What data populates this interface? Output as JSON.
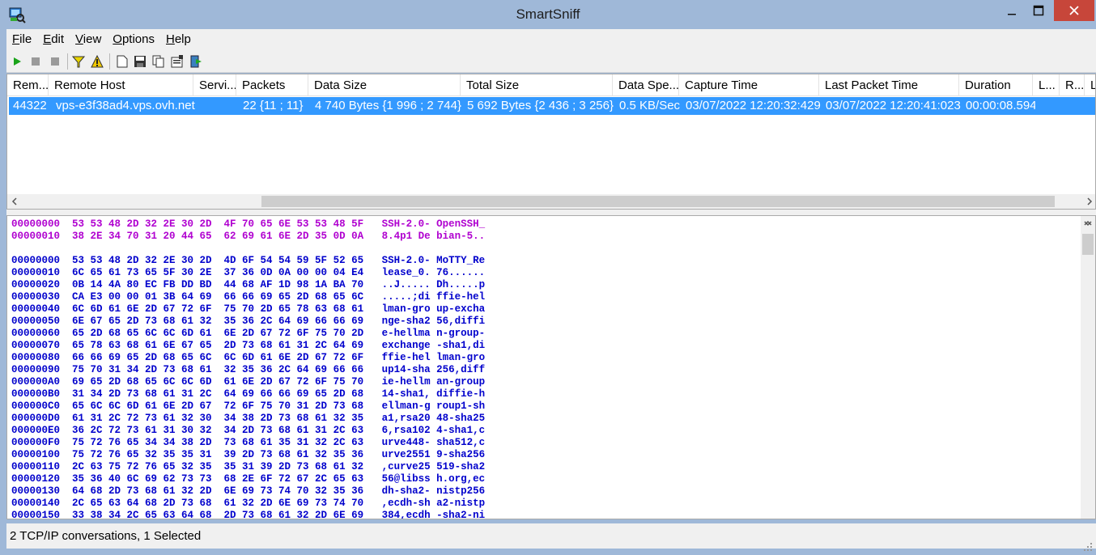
{
  "window": {
    "title": "SmartSniff",
    "colors": {
      "titlebar": "#9fb8d8",
      "close": "#c7463a",
      "selection": "#3399ff",
      "client_text": "#b000d0",
      "server_text": "#0000cc"
    }
  },
  "menu": [
    {
      "mnemonic": "F",
      "rest": "ile"
    },
    {
      "mnemonic": "E",
      "rest": "dit"
    },
    {
      "mnemonic": "V",
      "rest": "iew"
    },
    {
      "mnemonic": "O",
      "rest": "ptions"
    },
    {
      "mnemonic": "H",
      "rest": "elp"
    }
  ],
  "toolbar": {
    "icons": [
      "start-capture-icon",
      "stop-capture-icon",
      "pause-icon",
      "filter-icon",
      "warning-filter-icon",
      "new-file-icon",
      "save-icon",
      "copy-icon",
      "properties-icon",
      "exit-icon"
    ]
  },
  "columns": [
    "Rem...",
    "Remote Host",
    "Servi...",
    "Packets",
    "Data Size",
    "Total Size",
    "Data Spe...",
    "Capture Time",
    "Last Packet Time",
    "Duration",
    "L...",
    "R...",
    "L"
  ],
  "rows": [
    {
      "remote_port": "44322",
      "remote_host": "vps-e3f38ad4.vps.ovh.net",
      "service": "",
      "packets": "22  {11 ; 11}",
      "data_size": "4 740 Bytes  {1 996 ; 2 744}",
      "total_size": "5 692 Bytes  {2 436 ; 3 256}",
      "data_speed": "0.5 KB/Sec",
      "capture_time": "03/07/2022 12:20:32:429",
      "last_packet_time": "03/07/2022 12:20:41:023",
      "duration": "00:00:08.594"
    }
  ],
  "hex_dump": [
    {
      "kind": "client",
      "text": "00000000  53 53 48 2D 32 2E 30 2D  4F 70 65 6E 53 53 48 5F   SSH-2.0- OpenSSH_"
    },
    {
      "kind": "client",
      "text": "00000010  38 2E 34 70 31 20 44 65  62 69 61 6E 2D 35 0D 0A   8.4p1 De bian-5.."
    },
    {
      "kind": "blank",
      "text": ""
    },
    {
      "kind": "server",
      "text": "00000000  53 53 48 2D 32 2E 30 2D  4D 6F 54 54 59 5F 52 65   SSH-2.0- MoTTY_Re"
    },
    {
      "kind": "server",
      "text": "00000010  6C 65 61 73 65 5F 30 2E  37 36 0D 0A 00 00 04 E4   lease_0. 76......"
    },
    {
      "kind": "server",
      "text": "00000020  0B 14 4A 80 EC FB DD BD  44 68 AF 1D 98 1A BA 70   ..J..... Dh.....p"
    },
    {
      "kind": "server",
      "text": "00000030  CA E3 00 00 01 3B 64 69  66 66 69 65 2D 68 65 6C   .....;di ffie-hel"
    },
    {
      "kind": "server",
      "text": "00000040  6C 6D 61 6E 2D 67 72 6F  75 70 2D 65 78 63 68 61   lman-gro up-excha"
    },
    {
      "kind": "server",
      "text": "00000050  6E 67 65 2D 73 68 61 32  35 36 2C 64 69 66 66 69   nge-sha2 56,diffi"
    },
    {
      "kind": "server",
      "text": "00000060  65 2D 68 65 6C 6C 6D 61  6E 2D 67 72 6F 75 70 2D   e-hellma n-group-"
    },
    {
      "kind": "server",
      "text": "00000070  65 78 63 68 61 6E 67 65  2D 73 68 61 31 2C 64 69   exchange -sha1,di"
    },
    {
      "kind": "server",
      "text": "00000080  66 66 69 65 2D 68 65 6C  6C 6D 61 6E 2D 67 72 6F   ffie-hel lman-gro"
    },
    {
      "kind": "server",
      "text": "00000090  75 70 31 34 2D 73 68 61  32 35 36 2C 64 69 66 66   up14-sha 256,diff"
    },
    {
      "kind": "server",
      "text": "000000A0  69 65 2D 68 65 6C 6C 6D  61 6E 2D 67 72 6F 75 70   ie-hellm an-group"
    },
    {
      "kind": "server",
      "text": "000000B0  31 34 2D 73 68 61 31 2C  64 69 66 66 69 65 2D 68   14-sha1, diffie-h"
    },
    {
      "kind": "server",
      "text": "000000C0  65 6C 6C 6D 61 6E 2D 67  72 6F 75 70 31 2D 73 68   ellman-g roup1-sh"
    },
    {
      "kind": "server",
      "text": "000000D0  61 31 2C 72 73 61 32 30  34 38 2D 73 68 61 32 35   a1,rsa20 48-sha25"
    },
    {
      "kind": "server",
      "text": "000000E0  36 2C 72 73 61 31 30 32  34 2D 73 68 61 31 2C 63   6,rsa102 4-sha1,c"
    },
    {
      "kind": "server",
      "text": "000000F0  75 72 76 65 34 34 38 2D  73 68 61 35 31 32 2C 63   urve448- sha512,c"
    },
    {
      "kind": "server",
      "text": "00000100  75 72 76 65 32 35 35 31  39 2D 73 68 61 32 35 36   urve2551 9-sha256"
    },
    {
      "kind": "server",
      "text": "00000110  2C 63 75 72 76 65 32 35  35 31 39 2D 73 68 61 32   ,curve25 519-sha2"
    },
    {
      "kind": "server",
      "text": "00000120  35 36 40 6C 69 62 73 73  68 2E 6F 72 67 2C 65 63   56@libss h.org,ec"
    },
    {
      "kind": "server",
      "text": "00000130  64 68 2D 73 68 61 32 2D  6E 69 73 74 70 32 35 36   dh-sha2- nistp256"
    },
    {
      "kind": "server",
      "text": "00000140  2C 65 63 64 68 2D 73 68  61 32 2D 6E 69 73 74 70   ,ecdh-sh a2-nistp"
    },
    {
      "kind": "server",
      "text": "00000150  33 38 34 2C 65 63 64 68  2D 73 68 61 32 2D 6E 69   384,ecdh -sha2-ni"
    }
  ],
  "status": {
    "text": "2 TCP/IP conversations, 1 Selected"
  }
}
